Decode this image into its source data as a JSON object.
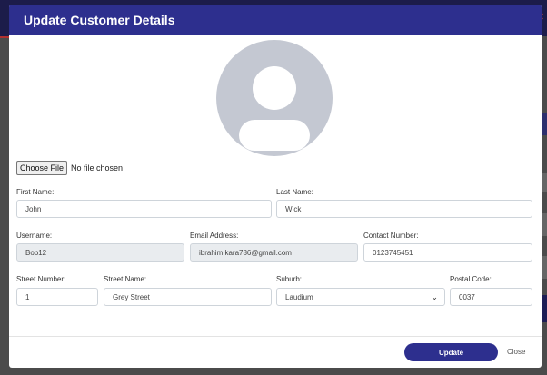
{
  "modal": {
    "title": "Update Customer Details"
  },
  "file_input": {
    "button_label": "Choose File",
    "status": "No file chosen"
  },
  "form": {
    "first_name": {
      "label": "First Name:",
      "value": "John"
    },
    "last_name": {
      "label": "Last Name:",
      "value": "Wick"
    },
    "username": {
      "label": "Username:",
      "value": "Bob12"
    },
    "email": {
      "label": "Email Address:",
      "value": "ibrahim.kara786@gmail.com"
    },
    "contact": {
      "label": "Contact Number:",
      "value": "0123745451"
    },
    "street_number": {
      "label": "Street Number:",
      "value": "1"
    },
    "street_name": {
      "label": "Street Name:",
      "value": "Grey Street"
    },
    "suburb": {
      "label": "Suburb:",
      "value": "Laudium"
    },
    "postal_code": {
      "label": "Postal Code:",
      "value": "0037"
    }
  },
  "footer": {
    "update_label": "Update",
    "close_label": "Close"
  },
  "colors": {
    "accent": "#2d2f8e",
    "avatar": "#c4c8d2"
  }
}
